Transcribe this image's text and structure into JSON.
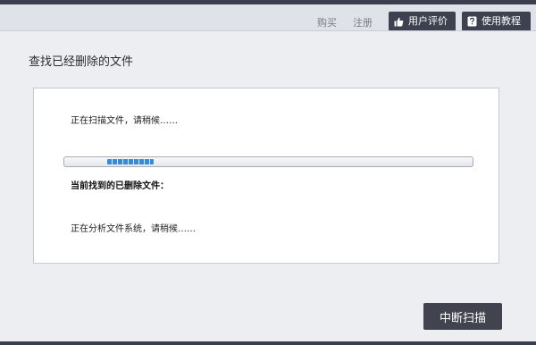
{
  "header": {
    "buy_link": "购买",
    "register_link": "注册",
    "review_button": {
      "label": "用户评价",
      "icon": "thumbs-up-icon"
    },
    "tutorial_button": {
      "label": "使用教程",
      "icon": "question-icon"
    }
  },
  "main": {
    "title": "查找已经删除的文件",
    "scan_status": "正在扫描文件，请稍候……",
    "found_label": "当前找到的已删除文件：",
    "analyze_status": "正在分析文件系统，请稍候……",
    "stop_button": "中断扫描"
  },
  "colors": {
    "dark_bar": "#3b3e4d",
    "button_bg": "#3d4150",
    "progress_blue": "#3f89d0",
    "background": "#eceef2"
  }
}
